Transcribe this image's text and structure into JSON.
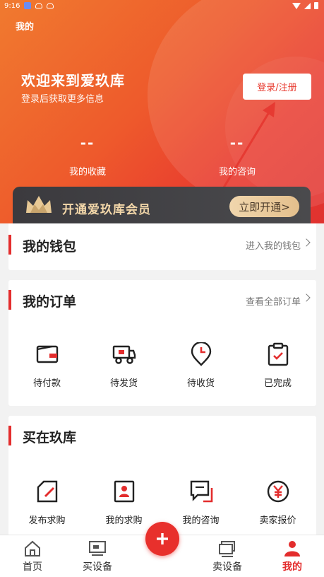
{
  "status_bar": {
    "time": "9:16"
  },
  "header": {
    "page_title": "我的",
    "welcome_title": "欢迎来到爱玖库",
    "welcome_subtitle": "登录后获取更多信息",
    "login_button": "登录/注册"
  },
  "stats": [
    {
      "value": "--",
      "label": "我的收藏"
    },
    {
      "value": "--",
      "label": "我的咨询"
    }
  ],
  "vip": {
    "text": "开通爱玖库会员",
    "button": "立即开通>"
  },
  "wallet": {
    "title": "我的钱包",
    "link": "进入我的钱包"
  },
  "orders": {
    "title": "我的订单",
    "link": "查看全部订单",
    "items": [
      {
        "label": "待付款",
        "icon": "wallet-icon"
      },
      {
        "label": "待发货",
        "icon": "truck-icon"
      },
      {
        "label": "待收货",
        "icon": "clock-pin-icon"
      },
      {
        "label": "已完成",
        "icon": "clipboard-check-icon"
      }
    ]
  },
  "buy_section": {
    "title": "买在玖库",
    "items": [
      {
        "label": "发布求购",
        "icon": "edit-doc-icon"
      },
      {
        "label": "我的求购",
        "icon": "user-doc-icon"
      },
      {
        "label": "我的咨询",
        "icon": "chat-icon"
      },
      {
        "label": "卖家报价",
        "icon": "yuan-icon"
      }
    ]
  },
  "bottom_nav": [
    {
      "label": "首页",
      "icon": "home-icon"
    },
    {
      "label": "买设备",
      "icon": "monitor-icon"
    },
    {
      "label": "卖设备",
      "icon": "stack-icon"
    },
    {
      "label": "我的",
      "icon": "person-icon",
      "active": true
    }
  ],
  "colors": {
    "accent": "#e32d2d",
    "vip_gold": "#f3d7a9"
  }
}
